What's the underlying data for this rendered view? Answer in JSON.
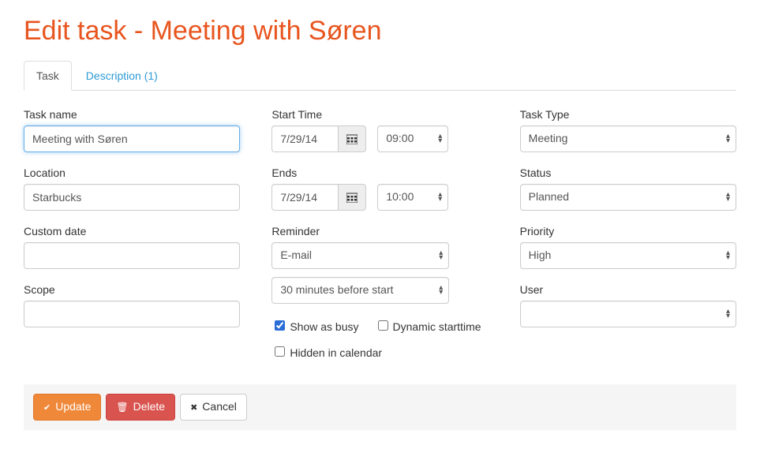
{
  "title": "Edit task - Meeting with Søren",
  "tabs": {
    "task": "Task",
    "description": "Description (1)"
  },
  "labels": {
    "task_name": "Task name",
    "location": "Location",
    "custom_date": "Custom date",
    "scope": "Scope",
    "start_time": "Start Time",
    "ends": "Ends",
    "reminder": "Reminder",
    "show_busy": "Show as busy",
    "dynamic_start": "Dynamic starttime",
    "hidden_cal": "Hidden in calendar",
    "task_type": "Task Type",
    "status": "Status",
    "priority": "Priority",
    "user": "User"
  },
  "values": {
    "task_name": "Meeting with Søren",
    "location": "Starbucks",
    "custom_date": "",
    "scope": "",
    "start_date": "7/29/14",
    "start_time": "09:00",
    "end_date": "7/29/14",
    "end_time": "10:00",
    "reminder_type": "E-mail",
    "reminder_when": "30 minutes before start",
    "task_type": "Meeting",
    "status": "Planned",
    "priority": "High",
    "user": ""
  },
  "checks": {
    "show_busy": true,
    "dynamic_start": false,
    "hidden_cal": false
  },
  "buttons": {
    "update": "Update",
    "delete": "Delete",
    "cancel": "Cancel"
  }
}
